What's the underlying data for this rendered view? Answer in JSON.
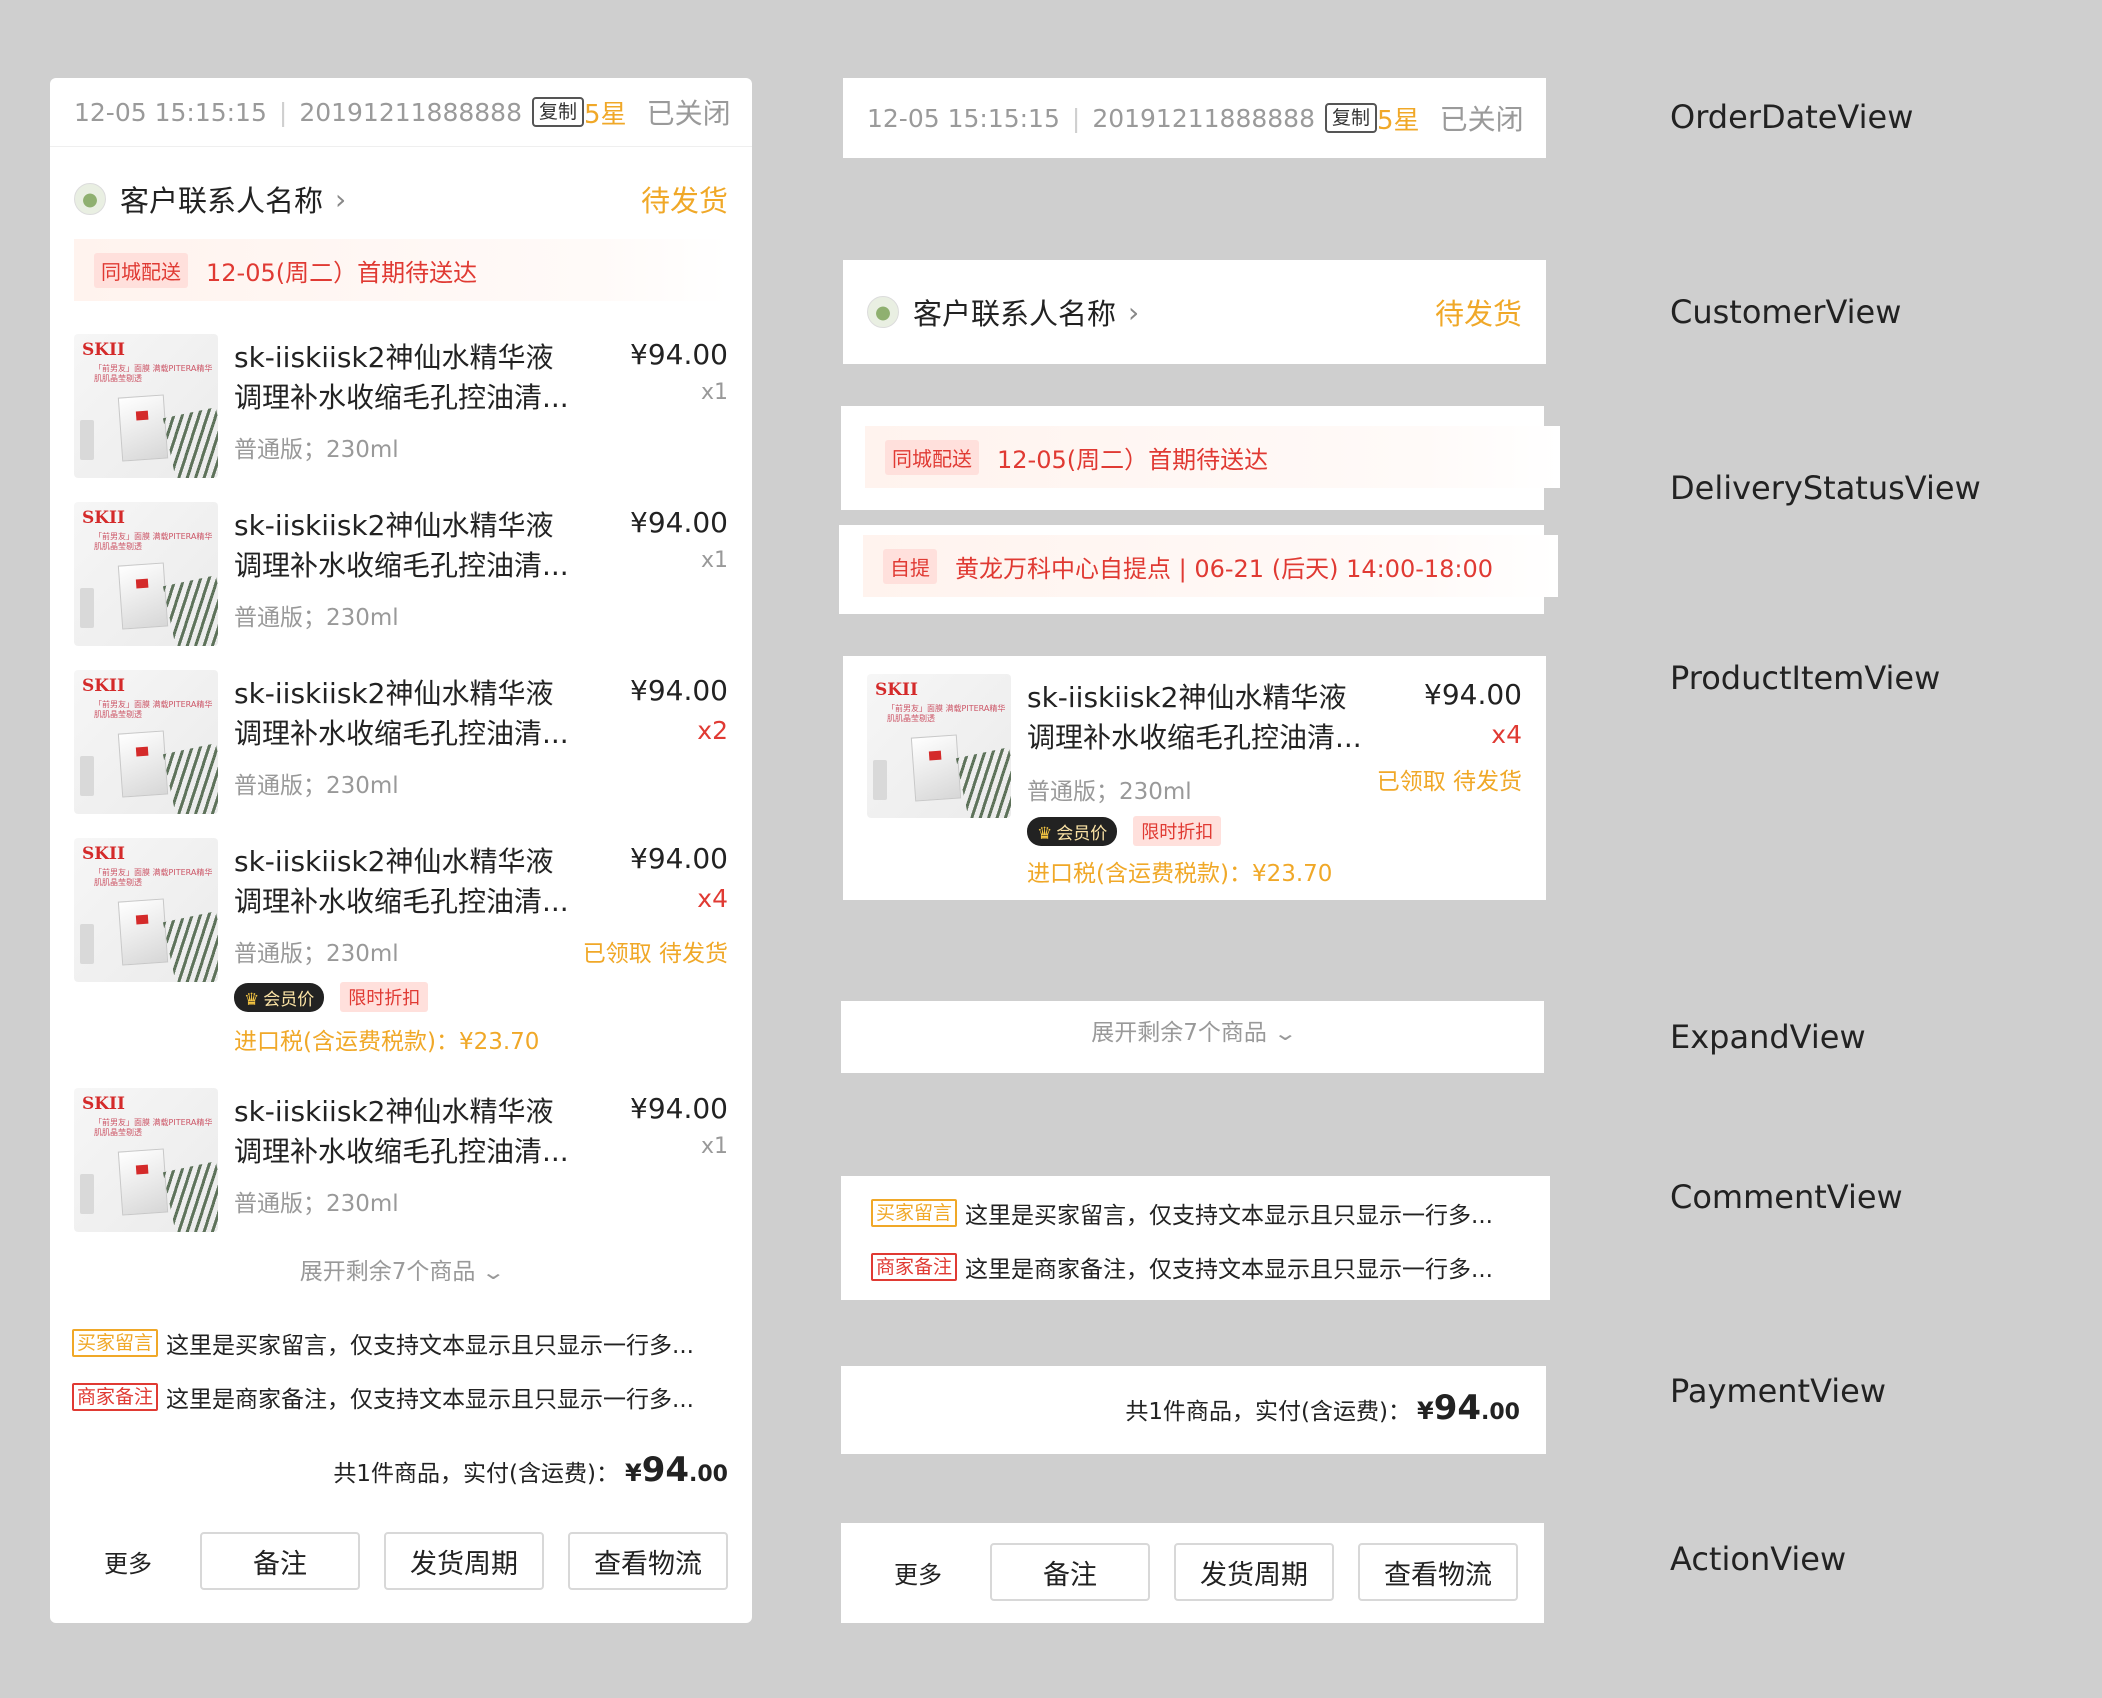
{
  "order": {
    "datetime": "12-05 15:15:15",
    "order_no": "20191211888888",
    "copy_label": "复制",
    "rating": "5星",
    "order_status": "已关闭"
  },
  "customer": {
    "name": "客户联系人名称",
    "status": "待发货"
  },
  "delivery": {
    "tag": "同城配送",
    "text": "12-05(周二）首期待送达"
  },
  "pickup": {
    "tag": "自提",
    "text": "黄龙万科中心自提点 | 06-21 (后天) 14:00-18:00"
  },
  "product_common": {
    "image_brand": "SKII",
    "image_caption": "「前男友」面膜 满载PITERA精华 肌肌晶莹剔透",
    "title_line1": "sk-iiskiisk2神仙水精华液",
    "title_line2": "调理补水收缩毛孔控油清...",
    "price": "¥94.00",
    "spec": "普通版；230ml"
  },
  "products": [
    {
      "qty": "x1",
      "qty_highlight": false
    },
    {
      "qty": "x1",
      "qty_highlight": false
    },
    {
      "qty": "x2",
      "qty_highlight": true
    },
    {
      "qty": "x4",
      "qty_highlight": true,
      "state": "已领取 待发货",
      "vip_tag": "会员价",
      "limit_tag": "限时折扣",
      "tax": "进口税(含运费税款)：¥23.70"
    },
    {
      "qty": "x1",
      "qty_highlight": false
    }
  ],
  "detail_product": {
    "qty": "x4",
    "state": "已领取 待发货",
    "vip_tag": "会员价",
    "limit_tag": "限时折扣",
    "tax": "进口税(含运费税款)：¥23.70"
  },
  "expand": {
    "label": "展开剩余7个商品"
  },
  "comments": {
    "buyer_tag": "买家留言",
    "buyer_text": "这里是买家留言，仅支持文本显示且只显示一行多...",
    "seller_tag": "商家备注",
    "seller_text": "这里是商家备注，仅支持文本显示且只显示一行多..."
  },
  "payment": {
    "label": "共1件商品，实付(含运费)：",
    "currency": "¥",
    "amount_int": "94",
    "amount_dec": ".00"
  },
  "actions": {
    "more": "更多",
    "note": "备注",
    "cycle": "发货周期",
    "logistics": "查看物流"
  },
  "labels": {
    "order_date": "OrderDateView",
    "customer": "CustomerView",
    "delivery_status": "DeliveryStatusView",
    "product_item": "ProductItemView",
    "expand": "ExpandView",
    "comment": "CommentView",
    "payment": "PaymentView",
    "action": "ActionView"
  },
  "colors": {
    "accent_orange": "#f0a828",
    "accent_red": "#e03a33",
    "background": "#cfcfcf"
  }
}
